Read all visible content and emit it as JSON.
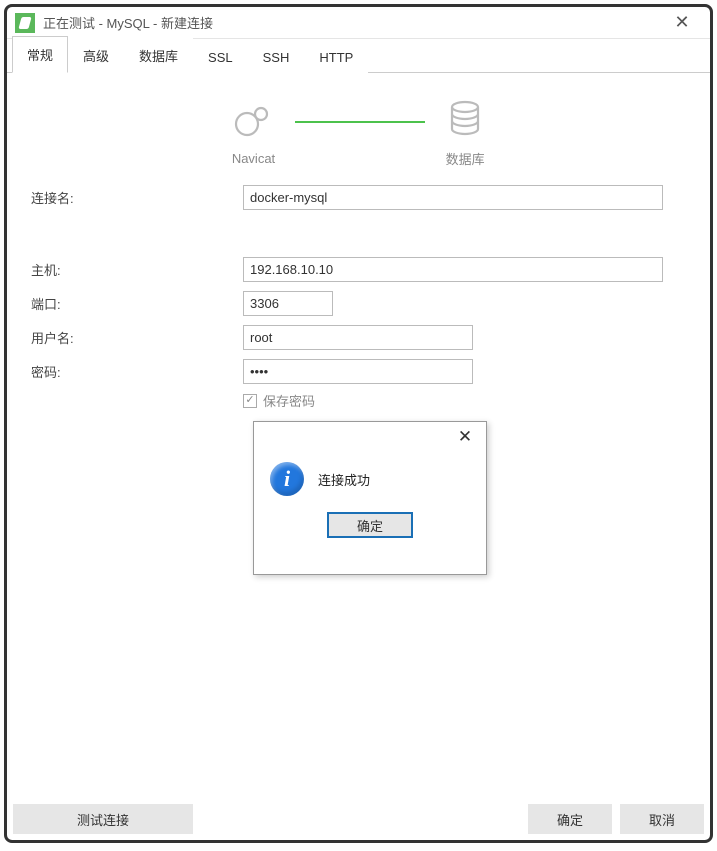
{
  "window": {
    "title": "正在测试 - MySQL - 新建连接"
  },
  "tabs": [
    {
      "label": "常规",
      "active": true
    },
    {
      "label": "高级",
      "active": false
    },
    {
      "label": "数据库",
      "active": false
    },
    {
      "label": "SSL",
      "active": false
    },
    {
      "label": "SSH",
      "active": false
    },
    {
      "label": "HTTP",
      "active": false
    }
  ],
  "diagram": {
    "left_label": "Navicat",
    "right_label": "数据库"
  },
  "form": {
    "connection_name": {
      "label": "连接名:",
      "value": "docker-mysql"
    },
    "host": {
      "label": "主机:",
      "value": "192.168.10.10"
    },
    "port": {
      "label": "端口:",
      "value": "3306"
    },
    "user": {
      "label": "用户名:",
      "value": "root"
    },
    "password": {
      "label": "密码:",
      "value": "••••"
    },
    "save_password": {
      "label": "保存密码",
      "checked": true
    }
  },
  "footer": {
    "test_btn": "测试连接",
    "ok_btn": "确定",
    "cancel_btn": "取消"
  },
  "modal": {
    "message": "连接成功",
    "ok": "确定"
  }
}
